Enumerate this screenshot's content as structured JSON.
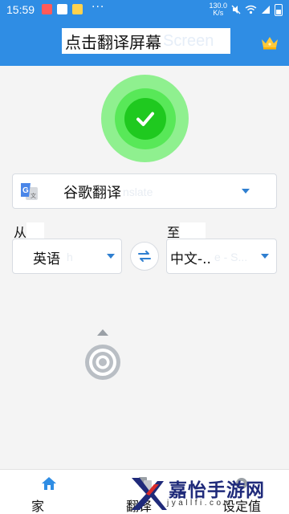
{
  "status_bar": {
    "time": "15:59",
    "dots": "···",
    "net_speed_value": "130.0",
    "net_speed_unit": "K/s",
    "icons": [
      "notification-icon",
      "image-icon",
      "app-icon",
      "mute-icon",
      "wifi-icon",
      "signal-icon",
      "battery-icon"
    ]
  },
  "header": {
    "title": "点击翻译屏幕",
    "title_ghost": "Screen",
    "crown_icon": "crown-icon"
  },
  "start_button": {
    "icon": "checkmark-icon"
  },
  "engine": {
    "label": "谷歌翻译",
    "ghost": "nslate",
    "icon": "google-translate-icon"
  },
  "languages": {
    "from_label": "从",
    "to_label": "至",
    "source": "英语",
    "source_ghost": "h",
    "target": "中文-..",
    "target_ghost": "e - S...",
    "swap_icon": "swap-icon"
  },
  "bottom_nav": [
    {
      "label": "家",
      "icon": "home-icon",
      "active": true
    },
    {
      "label": "翻译",
      "icon": "translate-icon",
      "active": false
    },
    {
      "label": "设定值",
      "icon": "settings-icon",
      "active": false
    }
  ],
  "watermark": {
    "title": "嘉怡手游网",
    "subtitle": "jyallfi.com"
  },
  "colors": {
    "primary": "#2f8de4",
    "go_outer": "#8ff08f",
    "go_mid": "#58e858",
    "go_inner": "#1fc91f",
    "watermark": "#1f2a7a"
  }
}
